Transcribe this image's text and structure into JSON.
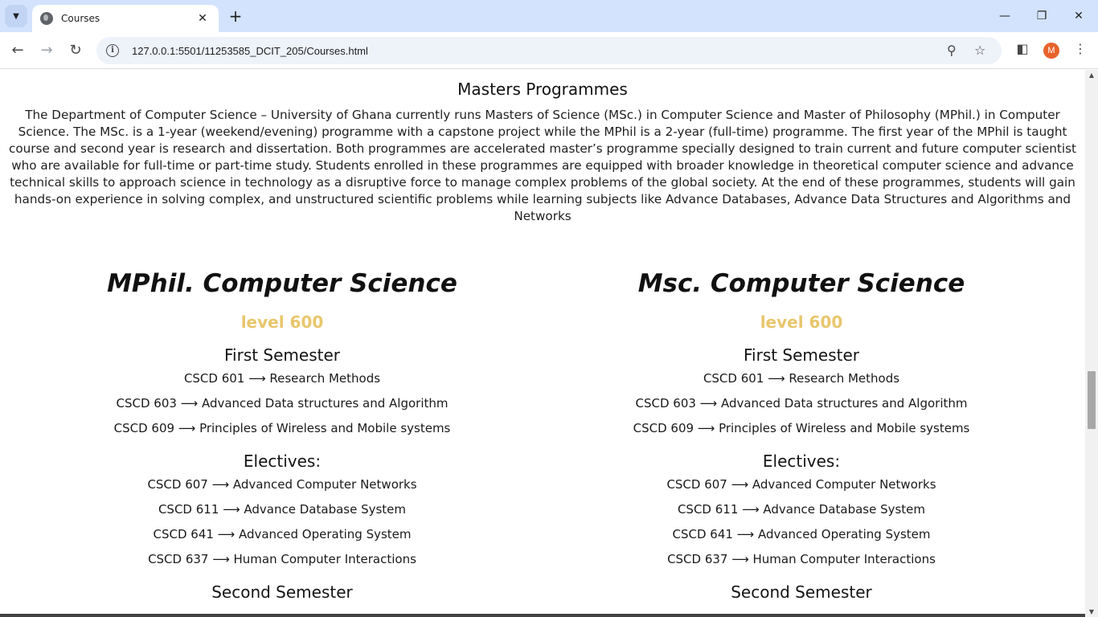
{
  "browser": {
    "tab_title": "Courses",
    "url": "127.0.0.1:5501/11253585_DCIT_205/Courses.html",
    "profile_initial": "M"
  },
  "masters": {
    "title": "Masters Programmes",
    "description": "The Department of Computer Science – University of Ghana currently runs Masters of Science (MSc.) in Computer Science and Master of Philosophy (MPhil.) in Computer Science. The MSc. is a 1-year (weekend/evening) programme with a capstone project while the MPhil is a 2-year (full-time) programme. The first year of the MPhil is taught course and second year is research and dissertation. Both programmes are accelerated master’s programme specially designed to train current and future computer scientist who are available for full-time or part-time study. Students enrolled in these programmes are equipped with broader knowledge in theoretical computer science and advance technical skills to approach science in technology as a disruptive force to manage complex problems of the global society. At the end of these programmes, students will gain hands-on experience in solving complex, and unstructured scientific problems while learning subjects like Advance Databases, Advance Data Structures and Algorithms and Networks"
  },
  "programmes": [
    {
      "title": "MPhil. Computer Science",
      "level": "level 600",
      "first_semester_heading": "First Semester",
      "first_semester": [
        "CSCD 601 ⟶ Research Methods",
        "CSCD 603 ⟶ Advanced Data structures and Algorithm",
        "CSCD 609 ⟶ Principles of Wireless and Mobile systems"
      ],
      "electives_heading": "Electives:",
      "electives": [
        "CSCD 607 ⟶ Advanced Computer Networks",
        "CSCD 611 ⟶ Advance Database System",
        "CSCD 641 ⟶ Advanced Operating System",
        "CSCD 637 ⟶ Human Computer Interactions"
      ],
      "second_semester_heading": "Second Semester"
    },
    {
      "title": "Msc. Computer Science",
      "level": "level 600",
      "first_semester_heading": "First Semester",
      "first_semester": [
        "CSCD 601 ⟶ Research Methods",
        "CSCD 603 ⟶ Advanced Data structures and Algorithm",
        "CSCD 609 ⟶ Principles of Wireless and Mobile systems"
      ],
      "electives_heading": "Electives:",
      "electives": [
        "CSCD 607 ⟶ Advanced Computer Networks",
        "CSCD 611 ⟶ Advance Database System",
        "CSCD 641 ⟶ Advanced Operating System",
        "CSCD 637 ⟶ Human Computer Interactions"
      ],
      "second_semester_heading": "Second Semester"
    }
  ],
  "colors": {
    "tab_strip": "#d3e3fd",
    "level_accent": "#e8c66b",
    "avatar": "#e8622c"
  }
}
